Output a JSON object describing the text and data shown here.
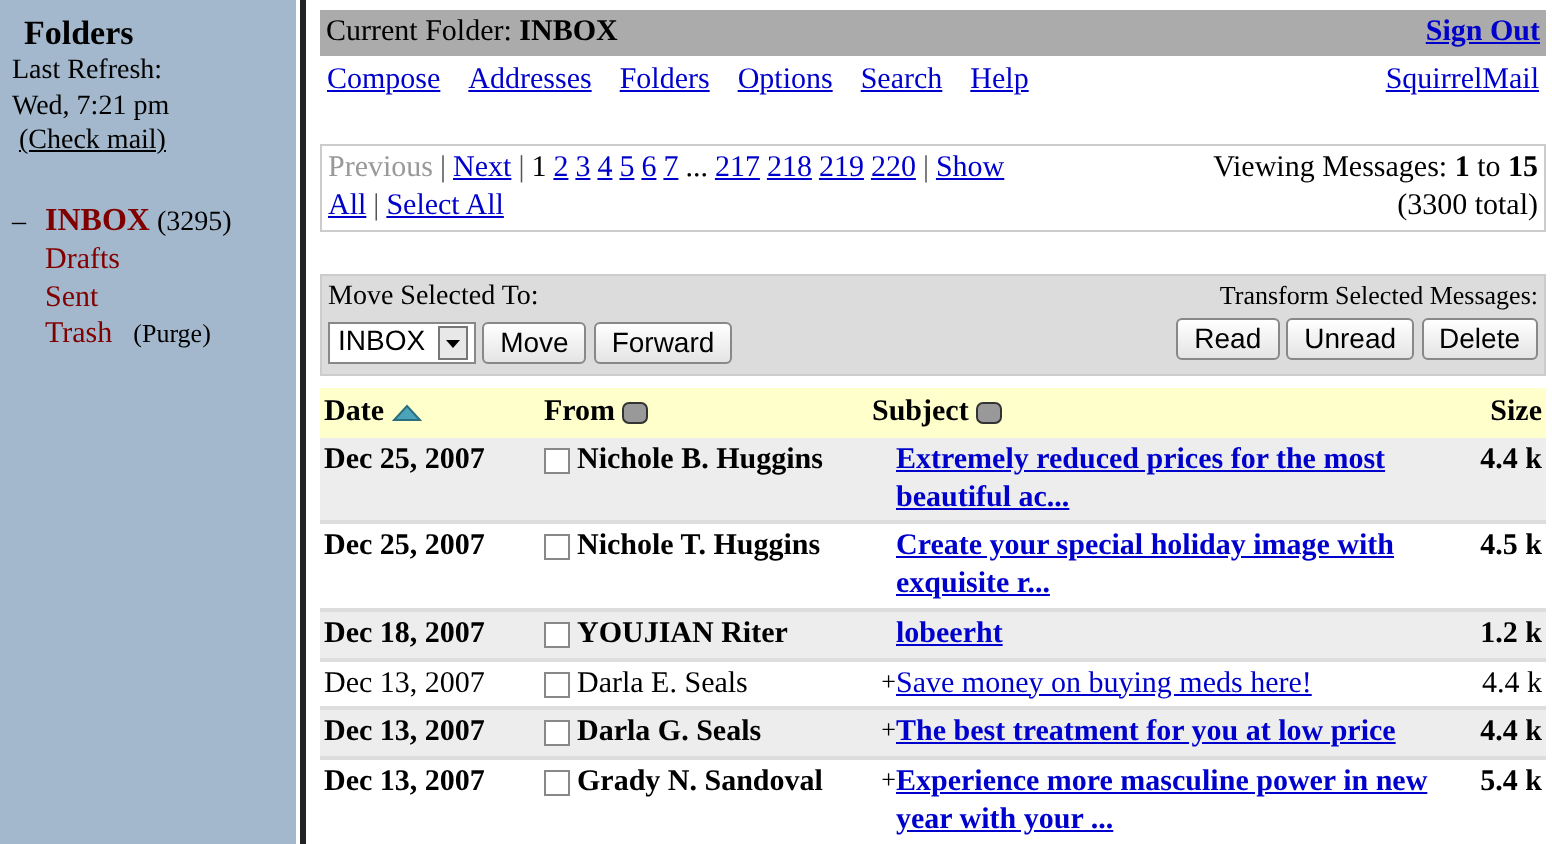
{
  "sidebar": {
    "title": "Folders",
    "refresh_label": "Last Refresh:",
    "refresh_time": "Wed, 7:21 pm",
    "check_mail": "(Check mail)",
    "folders": [
      {
        "name": "INBOX",
        "selected": true,
        "expanded": true,
        "toggle": "–",
        "count": "(3295)"
      },
      {
        "name": "Drafts",
        "selected": false
      },
      {
        "name": "Sent",
        "selected": false
      },
      {
        "name": "Trash",
        "selected": false,
        "action": "(Purge)"
      }
    ]
  },
  "header": {
    "current_folder_label": "Current Folder:",
    "current_folder": "INBOX",
    "sign_out": "Sign Out"
  },
  "nav": {
    "links": [
      "Compose",
      "Addresses",
      "Folders",
      "Options",
      "Search",
      "Help"
    ],
    "brand": "SquirrelMail"
  },
  "pager": {
    "lines": [
      [
        {
          "label": "Previous",
          "kind": "disabled"
        },
        {
          "label": "|",
          "kind": "sep"
        },
        {
          "label": "Next",
          "kind": "link"
        },
        {
          "label": "|",
          "kind": "sep"
        },
        {
          "label": "1",
          "kind": "current"
        },
        {
          "label": "2",
          "kind": "link"
        },
        {
          "label": "3",
          "kind": "link"
        },
        {
          "label": "4",
          "kind": "link"
        },
        {
          "label": "5",
          "kind": "link"
        },
        {
          "label": "6",
          "kind": "link"
        },
        {
          "label": "7",
          "kind": "link"
        },
        {
          "label": "...",
          "kind": "sep"
        },
        {
          "label": "217",
          "kind": "link"
        },
        {
          "label": "218",
          "kind": "link"
        },
        {
          "label": "219",
          "kind": "link"
        },
        {
          "label": "220",
          "kind": "link"
        },
        {
          "label": "|",
          "kind": "sep"
        },
        {
          "label": "Show",
          "kind": "link"
        }
      ],
      [
        {
          "label": "All",
          "kind": "link"
        },
        {
          "label": "|",
          "kind": "sep"
        },
        {
          "label": "Select All",
          "kind": "link"
        }
      ]
    ],
    "viewing": "Viewing Messages: **1** to **15**",
    "total": "(3300 total)"
  },
  "actions": {
    "move_label": "Move Selected To:",
    "folder_select": "INBOX",
    "left_buttons": [
      "Move",
      "Forward"
    ],
    "transform_label": "Transform Selected Messages:",
    "right_buttons": [
      "Read",
      "Unread",
      "Delete"
    ]
  },
  "table": {
    "columns": [
      {
        "label": "Date",
        "sortable": true,
        "sorted": true
      },
      {
        "label": "From",
        "sortable": true,
        "sorted": false
      },
      {
        "label": "Subject",
        "sortable": true,
        "sorted": false
      },
      {
        "label": "Size",
        "sortable": false
      }
    ],
    "rows": [
      {
        "date": "Dec 25, 2007",
        "from": "Nichole B. Huggins",
        "subject": "Extremely reduced prices for the most beautiful ac...",
        "size": "4.4 k",
        "unread": true,
        "checked": false
      },
      {
        "date": "Dec 25, 2007",
        "from": "Nichole T. Huggins",
        "subject": "Create your special holiday image with exquisite r...",
        "size": "4.5 k",
        "unread": true,
        "checked": false
      },
      {
        "date": "Dec 18, 2007",
        "from": "YOUJIAN Riter",
        "subject": "lobeerht",
        "size": "1.2 k",
        "unread": true,
        "checked": false
      },
      {
        "date": "Dec 13, 2007",
        "from": "Darla E. Seals",
        "flag": "+",
        "subject": "Save money on buying meds here!",
        "size": "4.4 k",
        "unread": false,
        "checked": false
      },
      {
        "date": "Dec 13, 2007",
        "from": "Darla G. Seals",
        "flag": "+",
        "subject": "The best treatment for you at low price",
        "size": "4.4 k",
        "unread": true,
        "checked": false
      },
      {
        "date": "Dec 13, 2007",
        "from": "Grady N. Sandoval",
        "flag": "+",
        "subject": "Experience more masculine power in new year with your ...",
        "size": "5.4 k",
        "unread": true,
        "checked": false
      }
    ]
  }
}
